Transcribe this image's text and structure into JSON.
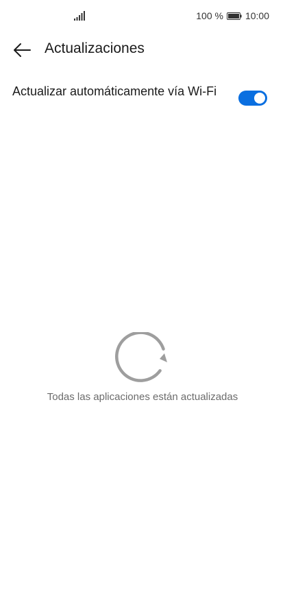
{
  "status_bar": {
    "battery_text": "100 %",
    "time": "10:00",
    "icons": [
      "signal-icon",
      "battery-icon"
    ]
  },
  "header": {
    "back_icon": "arrow-left-icon",
    "title": "Actualizaciones"
  },
  "settings": {
    "auto_update_label": "Actualizar automáticamente vía Wi-Fi",
    "auto_update_enabled": true
  },
  "empty_state": {
    "icon": "refresh-icon",
    "message": "Todas las aplicaciones están actualizadas"
  },
  "colors": {
    "accent": "#0a6fe0",
    "icon_gray": "#9e9e9e",
    "text_secondary": "#6b6b6b"
  }
}
